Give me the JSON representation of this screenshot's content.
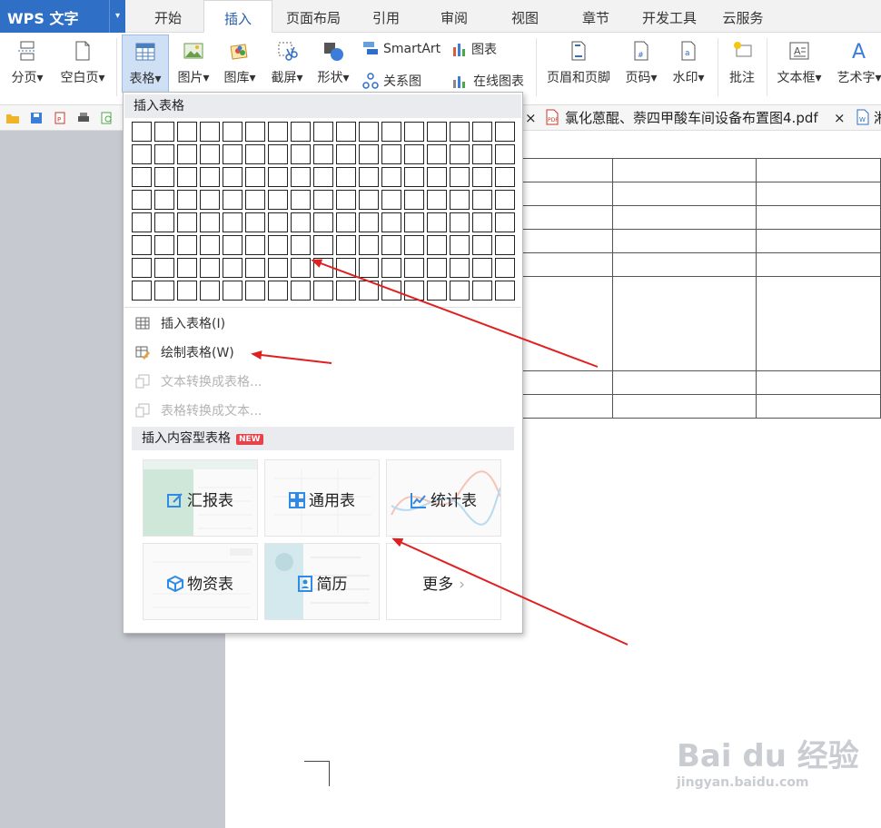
{
  "app": {
    "title": "WPS 文字",
    "dropdown": "▾"
  },
  "tabs": [
    {
      "label": "开始"
    },
    {
      "label": "插入",
      "active": true
    },
    {
      "label": "页面布局"
    },
    {
      "label": "引用"
    },
    {
      "label": "审阅"
    },
    {
      "label": "视图"
    },
    {
      "label": "章节"
    },
    {
      "label": "开发工具"
    },
    {
      "label": "云服务"
    }
  ],
  "ribbon": {
    "page_break": "分页",
    "blank_page": "空白页",
    "table": "表格",
    "picture": "图片",
    "gallery": "图库",
    "screenshot": "截屏",
    "shapes": "形状",
    "smartart": "SmartArt",
    "chart": "图表",
    "relation": "关系图",
    "online_chart": "在线图表",
    "header_footer": "页眉和页脚",
    "page_number": "页码",
    "watermark": "水印",
    "comment": "批注",
    "textbox": "文本框",
    "wordart": "艺术字"
  },
  "doc_tabs": {
    "close": "×",
    "pdf_name": "氯化蒽醌、萘四甲酸车间设备布置图4.pdf",
    "third_partial": "湘"
  },
  "menu": {
    "header": "插入表格",
    "grid_rows": 8,
    "grid_cols": 17,
    "items": [
      {
        "label": "插入表格(I)",
        "disabled": false
      },
      {
        "label": "绘制表格(W)",
        "disabled": false
      },
      {
        "label": "文本转换成表格...",
        "disabled": true
      },
      {
        "label": "表格转换成文本...",
        "disabled": true
      }
    ],
    "section2": "插入内容型表格",
    "new_badge": "NEW",
    "cards": [
      {
        "label": "汇报表",
        "icon": "report-icon"
      },
      {
        "label": "通用表",
        "icon": "grid-icon"
      },
      {
        "label": "统计表",
        "icon": "line-chart-icon"
      },
      {
        "label": "物资表",
        "icon": "box-icon"
      },
      {
        "label": "简历",
        "icon": "resume-icon"
      },
      {
        "label": "更多",
        "icon": "chevron-right-icon"
      }
    ]
  },
  "watermark": {
    "brand": "Bai du 经验",
    "url": "jingyan.baidu.com"
  },
  "colors": {
    "accent": "#2f6fc5",
    "arrow": "#e02020",
    "menu_header": "#e9ebee"
  }
}
